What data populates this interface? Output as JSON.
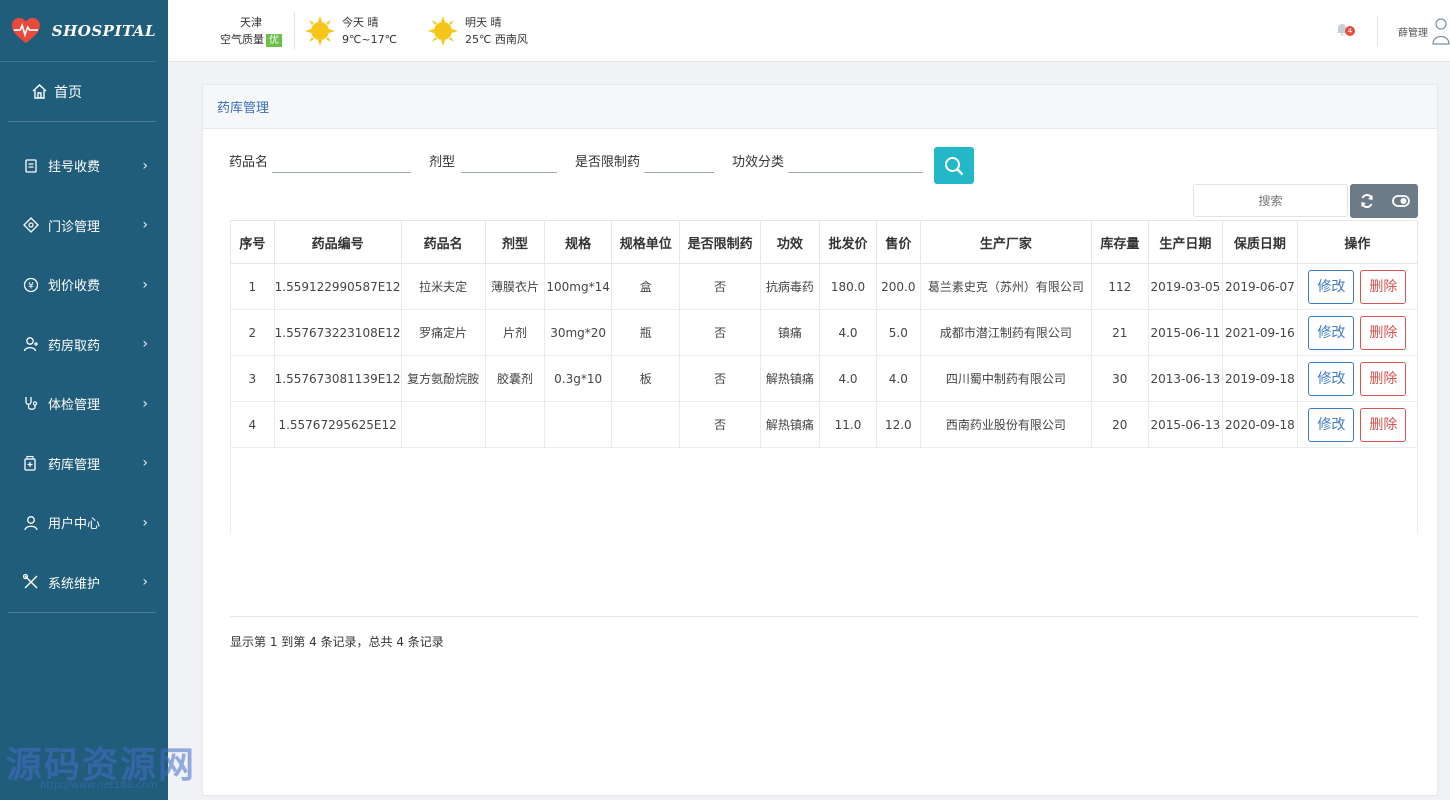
{
  "app": {
    "logo_text": "SHOSPITAL"
  },
  "sidebar": {
    "home": "首页",
    "items": [
      {
        "label": "挂号收费",
        "icon": "register-icon"
      },
      {
        "label": "门诊管理",
        "icon": "outpatient-icon"
      },
      {
        "label": "划价收费",
        "icon": "pricing-icon"
      },
      {
        "label": "药房取药",
        "icon": "pharmacy-icon"
      },
      {
        "label": "体检管理",
        "icon": "checkup-icon"
      },
      {
        "label": "药库管理",
        "icon": "drugstore-icon"
      },
      {
        "label": "用户中心",
        "icon": "user-center-icon"
      },
      {
        "label": "系统维护",
        "icon": "maintenance-icon"
      }
    ]
  },
  "header": {
    "city": "天津",
    "air_quality_label": "空气质量",
    "air_quality_value": "优",
    "today_label": "今天",
    "today_cond": "晴",
    "today_temp": "9℃~17℃",
    "tomorrow_label": "明天",
    "tomorrow_cond": "晴",
    "tomorrow_temp": "25℃ 西南风",
    "notifications": "4",
    "user_name": "薛管理"
  },
  "panel": {
    "title": "药库管理"
  },
  "filters": {
    "drug_name_label": "药品名",
    "dosage_form_label": "剂型",
    "restricted_label": "是否限制药",
    "efficacy_label": "功效分类"
  },
  "table_search": {
    "placeholder": "搜索"
  },
  "table": {
    "headers": [
      "序号",
      "药品编号",
      "药品名",
      "剂型",
      "规格",
      "规格单位",
      "是否限制药",
      "功效",
      "批发价",
      "售价",
      "生产厂家",
      "库存量",
      "生产日期",
      "保质日期",
      "操作"
    ],
    "rows": [
      [
        "1",
        "1.559122990587E12",
        "拉米夫定",
        "薄膜衣片",
        "100mg*14",
        "盒",
        "否",
        "抗病毒药",
        "180.0",
        "200.0",
        "葛兰素史克（苏州）有限公司",
        "112",
        "2019-03-05",
        "2019-06-07"
      ],
      [
        "2",
        "1.557673223108E12",
        "罗痛定片",
        "片剂",
        "30mg*20",
        "瓶",
        "否",
        "镇痛",
        "4.0",
        "5.0",
        "成都市潜江制药有限公司",
        "21",
        "2015-06-11",
        "2021-09-16"
      ],
      [
        "3",
        "1.557673081139E12",
        "复方氨酚烷胺",
        "胶囊剂",
        "0.3g*10",
        "板",
        "否",
        "解热镇痛",
        "4.0",
        "4.0",
        "四川蜀中制药有限公司",
        "30",
        "2013-06-13",
        "2019-09-18"
      ],
      [
        "4",
        "1.55767295625E12",
        "",
        "",
        "",
        "",
        "否",
        "解热镇痛",
        "11.0",
        "12.0",
        "西南药业股份有限公司",
        "20",
        "2015-06-13",
        "2020-09-18"
      ]
    ],
    "edit_label": "修改",
    "delete_label": "删除"
  },
  "pagination": {
    "info": "显示第 1 到第 4 条记录，总共 4 条记录"
  },
  "watermark": {
    "text": "源码资源网",
    "url": "http://www.net188.com"
  },
  "colors": {
    "sidebar": "#1f5d7a",
    "accent": "#23b7c7",
    "edit": "#3e7bc6",
    "delete": "#d9534f"
  }
}
